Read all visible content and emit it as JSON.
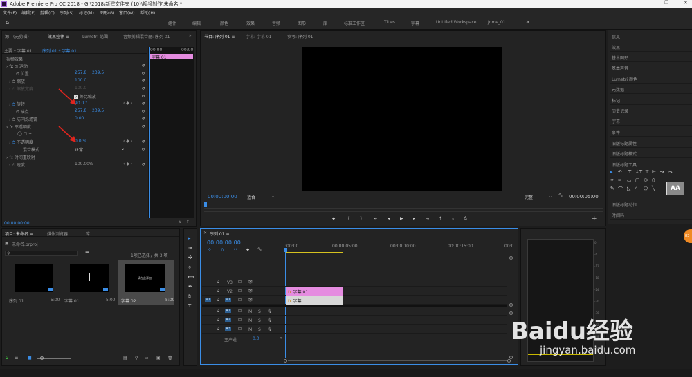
{
  "titlebar": {
    "title": "Adobe Premiere Pro CC 2018 - G:\\2018\\新建文件夹 (10)\\视频制作\\未命名 *"
  },
  "menu": [
    "文件(F)",
    "编辑(E)",
    "剪辑(C)",
    "序列(S)",
    "标记(M)",
    "图形(G)",
    "窗口(W)",
    "帮助(H)"
  ],
  "workspaces": [
    "组件",
    "编辑",
    "颜色",
    "效果",
    "音频",
    "图形",
    "库",
    "标准工作区",
    "Titles",
    "字幕",
    "Untitled Workspace",
    "Jome_01"
  ],
  "effect_controls": {
    "tabs": [
      "源：(无剪辑)",
      "效果控件 ≡",
      "Lumetri 范围",
      "音频剪辑混合器: 序列 01"
    ],
    "source": "主要 * 字幕 01",
    "clip": "序列 01 * 字幕 01",
    "ruler_start": "00:00",
    "ruler_mid": "00:00",
    "clip_label": "字幕 01",
    "video_effects": "视频效果",
    "motion": "运动",
    "position": {
      "label": "位置",
      "x": "257.8",
      "y": "239.5"
    },
    "scale": {
      "label": "缩放",
      "value": "100.0"
    },
    "scale_width": {
      "label": "缩放宽度",
      "value": "100.0"
    },
    "uniform": "等比缩放",
    "rotation": {
      "label": "旋转",
      "value": "90.0 °"
    },
    "anchor": {
      "label": "锚点",
      "x": "257.8",
      "y": "239.5"
    },
    "antiflicker": {
      "label": "防闪烁滤镜",
      "value": "0.00"
    },
    "opacity_section": "不透明度",
    "opacity": {
      "label": "不透明度",
      "value": "0.0 %"
    },
    "blend": {
      "label": "混合模式",
      "value": "正常"
    },
    "time_remap": "时间重映射",
    "speed": {
      "label": "速度",
      "value": "100.00%"
    },
    "timecode": "00:00:00:00"
  },
  "program": {
    "tabs": [
      "节目: 序列 01 ≡",
      "字幕: 字幕 01",
      "参考: 序列 01"
    ],
    "timecode": "00:00:00:00",
    "fit": "适合",
    "quality": "完整",
    "duration": "00:00:05:00"
  },
  "project": {
    "tabs": [
      "项目: 未命名 ≡",
      "媒体浏览器",
      "库"
    ],
    "file": "未命名.prproj",
    "selection": "1项已选择，共 3 项",
    "items": [
      {
        "name": "序列 01",
        "dur": "5:00"
      },
      {
        "name": "字幕 01",
        "dur": "5:00"
      },
      {
        "name": "字幕 02",
        "dur": "5:00"
      }
    ],
    "thumb_text": "请在此添加"
  },
  "timeline": {
    "tab": "序列 01 ≡",
    "timecode": "00:00:00:00",
    "ruler": [
      ":00:00",
      "00:00:05:00",
      "00:00:10:00",
      "00:00:15:00",
      "00:0"
    ],
    "tracks": [
      "V3",
      "V2",
      "V1",
      "A1",
      "A2",
      "A3"
    ],
    "source_v": "V1",
    "master": "主声道",
    "master_val": "0.0",
    "clip_v2": "字幕 01",
    "clip_v1": "字幕 ..."
  },
  "right_panels": [
    "信息",
    "效果",
    "基本图形",
    "基本声音",
    "Lumetri 颜色",
    "元数据",
    "标记",
    "历史记录",
    "字幕",
    "事件",
    "旧版标题属性",
    "旧版标题样式",
    "旧版标题工具",
    "旧版标题动作",
    "时间码"
  ],
  "audio_meter": [
    "0",
    "-6",
    "-12",
    "-18",
    "-24",
    "-30",
    "-36",
    "-42",
    "-48",
    "-54"
  ],
  "watermark": {
    "brand": "Baidu经验",
    "url": "jingyan.baidu.com"
  },
  "colors": {
    "accent": "#3a8de6",
    "clip_pink": "#e58ce0",
    "playhead": "#3a8de6",
    "arrow": "#e0251e"
  }
}
